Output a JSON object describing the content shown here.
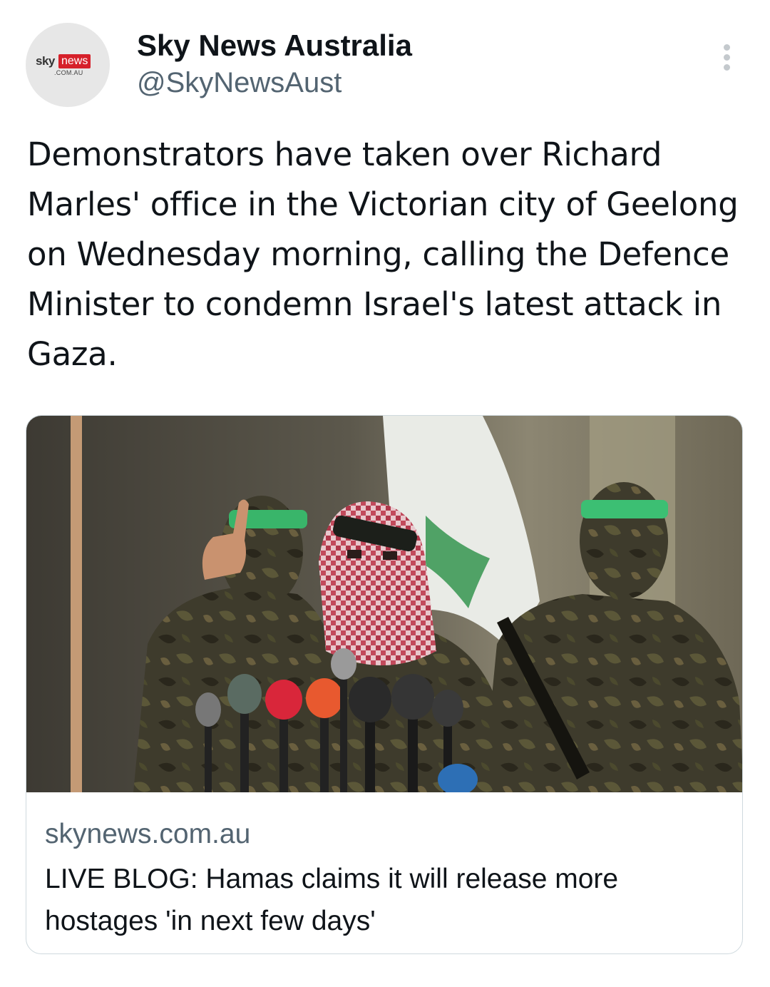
{
  "tweet": {
    "author": {
      "display_name": "Sky News Australia",
      "handle": "@SkyNewsAust",
      "avatar": {
        "logo_sky": "sky",
        "logo_news": "news",
        "logo_domain": ".COM.AU"
      }
    },
    "text": "Demonstrators have taken over Richard Marles' office in the Victorian city of Geelong on Wednesday morning, calling the Defence Minister to condemn Israel's latest attack in Gaza.",
    "more_icon": "more-vertical-icon",
    "card": {
      "image_description_icon": "photo",
      "domain": "skynews.com.au",
      "title": "LIVE BLOG: Hamas claims it will release more hostages 'in next few days'"
    }
  },
  "colors": {
    "text_primary": "#0f1419",
    "text_secondary": "#536471",
    "border": "#cfd9de",
    "brand_red": "#d6202a"
  }
}
